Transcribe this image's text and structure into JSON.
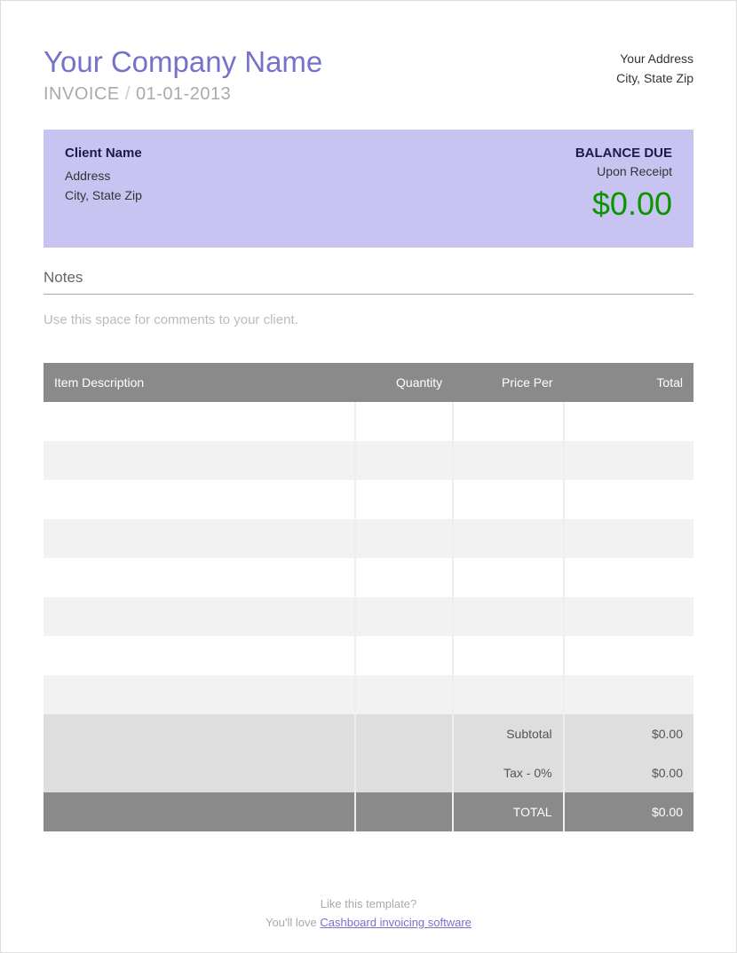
{
  "header": {
    "company_name": "Your Company Name",
    "invoice_label": "INVOICE",
    "invoice_date": "01-01-2013",
    "your_address_line1": "Your Address",
    "your_address_line2": "City, State Zip"
  },
  "client": {
    "name": "Client Name",
    "address_line1": "Address",
    "address_line2": "City, State Zip",
    "balance_due_label": "BALANCE DUE",
    "terms": "Upon Receipt",
    "amount": "$0.00"
  },
  "notes": {
    "heading": "Notes",
    "placeholder": "Use this space for comments to your client."
  },
  "table": {
    "headers": {
      "description": "Item Description",
      "quantity": "Quantity",
      "price": "Price Per",
      "total": "Total"
    },
    "rows": [
      {
        "desc": "",
        "qty": "",
        "price": "",
        "total": ""
      },
      {
        "desc": "",
        "qty": "",
        "price": "",
        "total": ""
      },
      {
        "desc": "",
        "qty": "",
        "price": "",
        "total": ""
      },
      {
        "desc": "",
        "qty": "",
        "price": "",
        "total": ""
      },
      {
        "desc": "",
        "qty": "",
        "price": "",
        "total": ""
      },
      {
        "desc": "",
        "qty": "",
        "price": "",
        "total": ""
      },
      {
        "desc": "",
        "qty": "",
        "price": "",
        "total": ""
      },
      {
        "desc": "",
        "qty": "",
        "price": "",
        "total": ""
      }
    ],
    "summary": {
      "subtotal_label": "Subtotal",
      "subtotal_value": "$0.00",
      "tax_label": "Tax - 0%",
      "tax_value": "$0.00",
      "total_label": "TOTAL",
      "total_value": "$0.00"
    }
  },
  "footer": {
    "line1": "Like this template?",
    "line2_prefix": "You'll love ",
    "link_text": "Cashboard invoicing software"
  }
}
